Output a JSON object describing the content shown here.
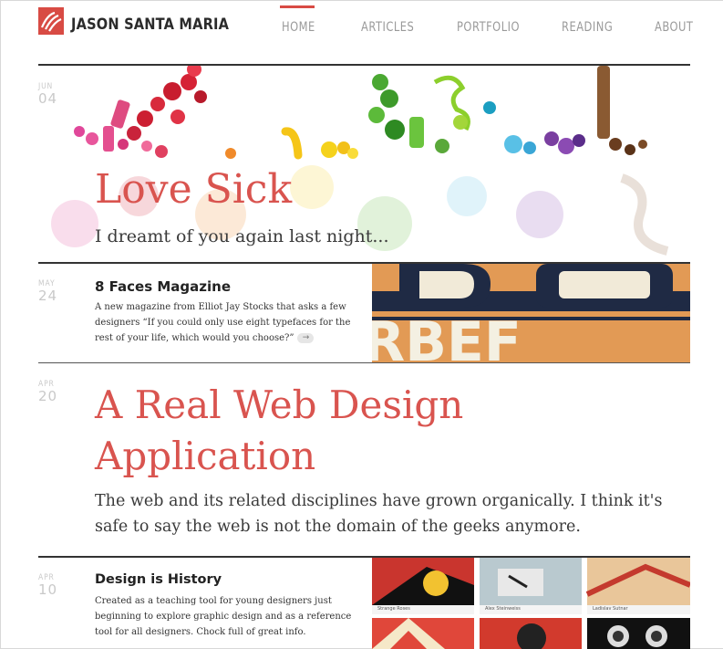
{
  "site": {
    "title": "JASON SANTA MARIA"
  },
  "nav": [
    {
      "label": "HOME",
      "active": true
    },
    {
      "label": "ARTICLES",
      "active": false
    },
    {
      "label": "PORTFOLIO",
      "active": false
    },
    {
      "label": "READING",
      "active": false
    },
    {
      "label": "ABOUT",
      "active": false
    }
  ],
  "posts": [
    {
      "month": "JUN",
      "day": "04",
      "title": "Love Sick",
      "excerpt": "I dreamt of you again last night..."
    },
    {
      "month": "MAY",
      "day": "24",
      "title": "8 Faces Magazine",
      "excerpt_lines": [
        "A new magazine from Elliot Jay Stocks that asks a few",
        "designers “If you could only use eight typefaces for the",
        "rest of your life, which would you choose?”"
      ],
      "more": "→"
    },
    {
      "month": "APR",
      "day": "20",
      "title_lines": [
        "A Real Web Design",
        "Application"
      ],
      "excerpt_lines": [
        "The web and its related disciplines have grown organically. I think it's",
        "safe to say the web is not the domain of the geeks anymore."
      ]
    },
    {
      "month": "APR",
      "day": "10",
      "title": "Design is History",
      "excerpt_lines": [
        "Created as a teaching tool for young designers just",
        "beginning to explore graphic design and as a reference",
        "tool for all designers. Chock full of great info."
      ],
      "thumb_captions": [
        "Strange Roses",
        "Alex Steinweiss",
        "Ladislav Sutnar"
      ]
    }
  ],
  "colors": {
    "accent": "#d9544f",
    "rule": "#333333",
    "date": "#c9c9c9"
  }
}
